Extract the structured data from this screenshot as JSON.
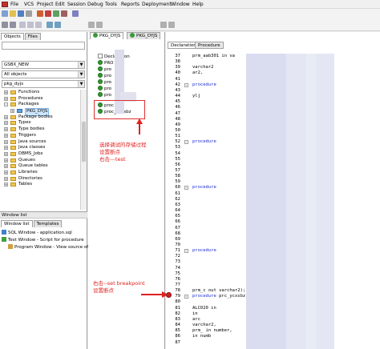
{
  "menubar": {
    "items": [
      "File",
      "VCS",
      "Project",
      "Edit",
      "Session",
      "Debug",
      "Tools",
      "Reports",
      "Deployment",
      "Window",
      "Help"
    ]
  },
  "objects_panel": {
    "tabs": [
      "Objects",
      "Files"
    ],
    "connection": "GSBX_NEW",
    "filter": "All objects",
    "search": "pkg_dyjs",
    "tree": [
      {
        "label": "Functions",
        "expander": "+"
      },
      {
        "label": "Procedures",
        "expander": "+"
      },
      {
        "label": "Packages",
        "expander": "-"
      },
      {
        "label": "PKG_DYJS",
        "selected": true
      },
      {
        "label": "Package bodies",
        "expander": "+"
      },
      {
        "label": "Types",
        "expander": "+"
      },
      {
        "label": "Type bodies",
        "expander": "+"
      },
      {
        "label": "Triggers",
        "expander": "+"
      },
      {
        "label": "Java sources",
        "expander": "+"
      },
      {
        "label": "Java classes",
        "expander": "+"
      },
      {
        "label": "DBMS_Jobs",
        "expander": "+"
      },
      {
        "label": "Queues",
        "expander": "+"
      },
      {
        "label": "Queue tables",
        "expander": "+"
      },
      {
        "label": "Libraries",
        "expander": "+"
      },
      {
        "label": "Directories",
        "expander": "+"
      },
      {
        "label": "Tables",
        "expander": "+"
      }
    ]
  },
  "window_list": {
    "title": "Window list",
    "tabs": [
      "Window list",
      "Templates"
    ],
    "items": [
      {
        "label": "SQL Window - application.sql"
      },
      {
        "label": "Test Window - Script for procedure"
      },
      {
        "label": "Program Window - View source of"
      }
    ]
  },
  "middle_panel": {
    "tabs": [
      "PKG_DYJS",
      "PKG_DYJS"
    ],
    "items": [
      "Declaration",
      "PRO",
      "pro",
      "pro",
      "pro",
      "pro",
      "pro",
      "proc",
      "proc_ycxsbz"
    ]
  },
  "annotations": {
    "select_proc": "选择调试的存储过程\n设置断点\n右击---test",
    "set_breakpoint": "右击--set breakpoint\n设置断点"
  },
  "editor": {
    "tabs": [
      "Declaration",
      "Procedure"
    ],
    "lines": [
      {
        "n": "37",
        "text": "             prm_aab301  in va"
      },
      {
        "n": "38",
        "text": ""
      },
      {
        "n": "39",
        "text": "                                 varchar2"
      },
      {
        "n": "40",
        "text": "                                 ar2,"
      },
      {
        "n": "41",
        "text": ""
      },
      {
        "n": "42",
        "text": "procedure"
      },
      {
        "n": "43",
        "text": ""
      },
      {
        "n": "44",
        "text": "                 ylj"
      },
      {
        "n": "45",
        "text": ""
      },
      {
        "n": "46",
        "text": ""
      },
      {
        "n": "47",
        "text": ""
      },
      {
        "n": "48",
        "text": ""
      },
      {
        "n": "49",
        "text": ""
      },
      {
        "n": "50",
        "text": ""
      },
      {
        "n": "51",
        "text": ""
      },
      {
        "n": "52",
        "text": "procedure"
      },
      {
        "n": "53",
        "text": ""
      },
      {
        "n": "54",
        "text": ""
      },
      {
        "n": "55",
        "text": ""
      },
      {
        "n": "56",
        "text": ""
      },
      {
        "n": "57",
        "text": ""
      },
      {
        "n": "58",
        "text": ""
      },
      {
        "n": "59",
        "text": ""
      },
      {
        "n": "60",
        "text": "procedure"
      },
      {
        "n": "61",
        "text": ""
      },
      {
        "n": "62",
        "text": ""
      },
      {
        "n": "63",
        "text": ""
      },
      {
        "n": "64",
        "text": ""
      },
      {
        "n": "65",
        "text": ""
      },
      {
        "n": "66",
        "text": ""
      },
      {
        "n": "67",
        "text": ""
      },
      {
        "n": "68",
        "text": ""
      },
      {
        "n": "69",
        "text": ""
      },
      {
        "n": "70",
        "text": ""
      },
      {
        "n": "71",
        "text": "procedure"
      },
      {
        "n": "72",
        "text": ""
      },
      {
        "n": "73",
        "text": ""
      },
      {
        "n": "74",
        "text": ""
      },
      {
        "n": "75",
        "text": ""
      },
      {
        "n": "76",
        "text": ""
      },
      {
        "n": "77",
        "text": ""
      },
      {
        "n": "78",
        "text": "             prm_c         out varchar2);"
      },
      {
        "n": "79",
        "text": "procedure prc_ycxsbz"
      },
      {
        "n": "80",
        "text": ""
      },
      {
        "n": "81",
        "text": "             ALC020        in"
      },
      {
        "n": "82",
        "text": "                           in"
      },
      {
        "n": "83",
        "text": "                           arc"
      },
      {
        "n": "84",
        "text": "                           varchar2,"
      },
      {
        "n": "85",
        "text": "             prm_           in number,"
      },
      {
        "n": "86",
        "text": "                           in numb"
      },
      {
        "n": "87",
        "text": ""
      }
    ]
  },
  "colors": {
    "annotation_red": "#e02020",
    "keyword_blue": "#1a2ad0",
    "tree_green": "#2e9a2e"
  }
}
